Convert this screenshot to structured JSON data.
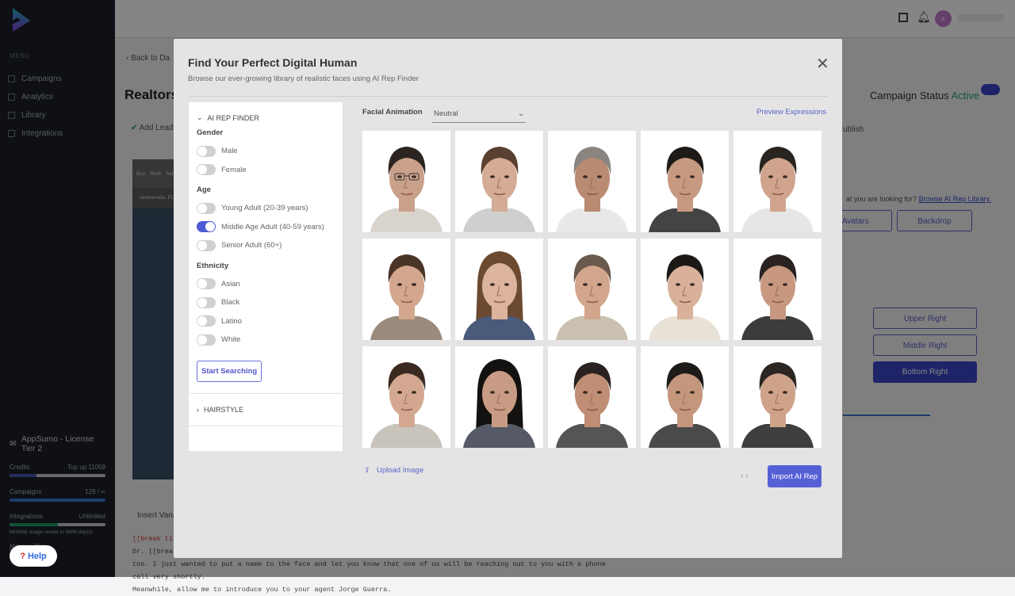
{
  "sidebar": {
    "menu_label": "MENU",
    "items": [
      {
        "label": "Campaigns",
        "icon": "grid-icon"
      },
      {
        "label": "Analytics",
        "icon": "bar-chart-icon"
      },
      {
        "label": "Library",
        "icon": "library-icon"
      },
      {
        "label": "Integrations",
        "icon": "integrations-icon"
      }
    ],
    "plan": {
      "title": "AppSumo - License Tier 2",
      "credits_label": "Credits",
      "credits_action": "Top up",
      "credits_value": "11059",
      "credits_fraction": 0.28,
      "campaigns_label": "Campaigns",
      "campaigns_value": "129 / ∞",
      "campaigns_fraction": 1.0,
      "integrations_label": "Integrations",
      "integrations_value": "Unlimited",
      "integrations_fraction": 0.5,
      "reset_text": "Monthly usage resets in 5606 day(s)",
      "manage": "Manage Plan"
    },
    "help": "Help"
  },
  "topbar": {
    "avatar_initial": "s"
  },
  "background": {
    "back": "Back to Da",
    "title": "Realtors",
    "add_leads": "Add Leads",
    "publish": "ublish",
    "campaign_status_label": "Campaign Status",
    "campaign_status": "Active",
    "browse_prompt": "at you are looking for?",
    "browse_link": "Browse AI Rep Library.",
    "avatars_btn": "y Avatars",
    "backdrop_btn": "Backdrop",
    "upper_right": "Upper Right",
    "middle_right": "Middle Right",
    "bottom_right": "Bottom Right",
    "map_tabs": [
      "Buy",
      "Rent",
      "Sel"
    ],
    "map_location": "Islamorada, FL",
    "insert_var": "Insert Variab",
    "script_lines": [
      "[[break ti",
      "Dr. [[brea",
      "too. I just wanted to put a name to the face and let you know that one of us will be reaching out to you with a phone call very shortly.",
      "Meanwhile, allow me to introduce you to your agent Jorge Guerra."
    ]
  },
  "modal": {
    "title": "Find Your Perfect Digital Human",
    "subtitle": "Browse our ever-growing library of realistic faces using AI Rep Finder",
    "finder_label": "AI REP FINDER",
    "hairstyle_label": "HAIRSTYLE",
    "groups": [
      {
        "label": "Gender",
        "options": [
          {
            "label": "Male",
            "on": false
          },
          {
            "label": "Female",
            "on": false
          }
        ]
      },
      {
        "label": "Age",
        "options": [
          {
            "label": "Young Adult (20-39 years)",
            "on": false
          },
          {
            "label": "Middle Age Adult (40-59 years)",
            "on": true
          },
          {
            "label": "Senior Adult (60+)",
            "on": false
          }
        ]
      },
      {
        "label": "Ethnicity",
        "options": [
          {
            "label": "Asian",
            "on": false
          },
          {
            "label": "Black",
            "on": false
          },
          {
            "label": "Latino",
            "on": false
          },
          {
            "label": "White",
            "on": false
          }
        ]
      }
    ],
    "start_searching": "Start Searching",
    "facial_animation_label": "Facial Animation",
    "facial_animation_value": "Neutral",
    "preview_expressions": "Preview Expressions",
    "upload_image": "Upload Image",
    "pager": "‹ ›",
    "import": "Import AI Rep",
    "faces": [
      {
        "hair": "#2b2420",
        "shirt": "#d8d4cc",
        "skin": "#c9a08a",
        "glasses": true
      },
      {
        "hair": "#5a4030",
        "shirt": "#cfcfcf",
        "skin": "#d4ab95"
      },
      {
        "hair": "#8a8580",
        "shirt": "#e8e8e8",
        "skin": "#b88b72"
      },
      {
        "hair": "#1e1a18",
        "shirt": "#444",
        "skin": "#c69a80"
      },
      {
        "hair": "#2a2420",
        "shirt": "#e6e6e6",
        "skin": "#d0a48c"
      },
      {
        "hair": "#4a3426",
        "shirt": "#9a8a7c",
        "skin": "#d3a68e"
      },
      {
        "hair": "#6b4a30",
        "shirt": "#4a5a7a",
        "skin": "#dcb39c",
        "long": true
      },
      {
        "hair": "#6a5a4c",
        "shirt": "#c9c0b2",
        "skin": "#d2a58d"
      },
      {
        "hair": "#1c1816",
        "shirt": "#e8e2d6",
        "skin": "#d9b19a"
      },
      {
        "hair": "#2a2220",
        "shirt": "#3c3c3c",
        "skin": "#c7987f"
      },
      {
        "hair": "#3a2a20",
        "shirt": "#c8c4bc",
        "skin": "#d4a890"
      },
      {
        "hair": "#141210",
        "shirt": "#555a66",
        "skin": "#c89c84",
        "long": true
      },
      {
        "hair": "#2a2220",
        "shirt": "#555",
        "skin": "#c08e74"
      },
      {
        "hair": "#1e1a18",
        "shirt": "#4a4a4a",
        "skin": "#c4967c"
      },
      {
        "hair": "#2c2622",
        "shirt": "#3e3e3e",
        "skin": "#cfa28a"
      }
    ]
  }
}
